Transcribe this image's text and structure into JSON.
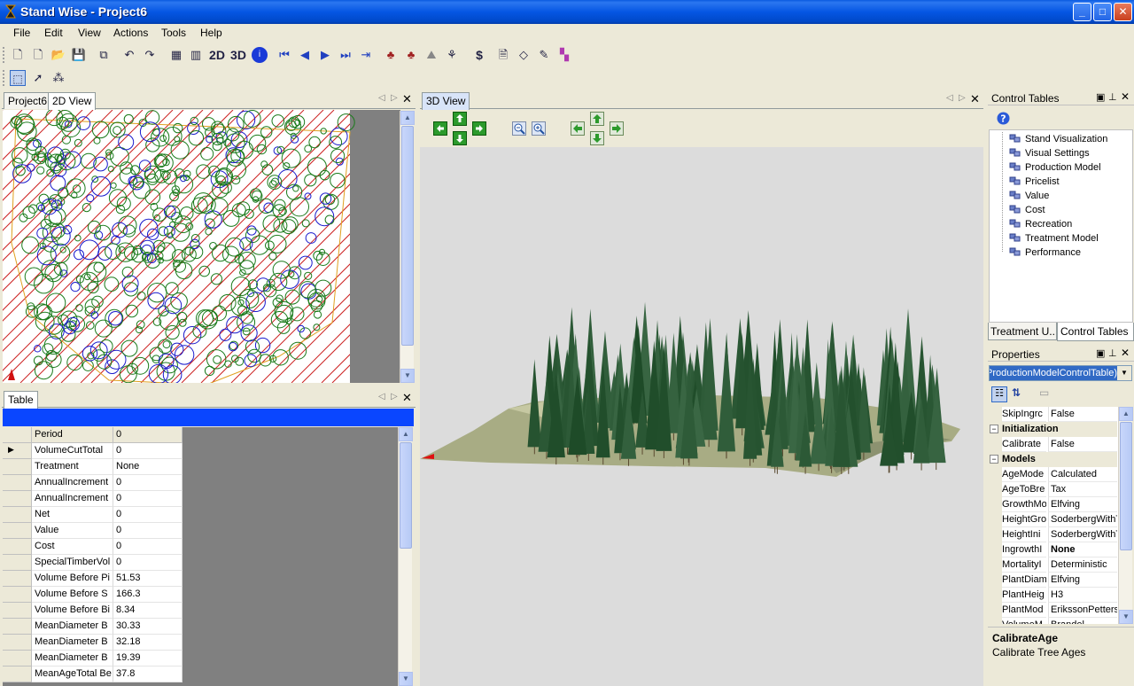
{
  "window": {
    "title": "Stand Wise - Project6",
    "controls": {
      "minimize": "_",
      "maximize": "□",
      "close": "✕"
    }
  },
  "menu": [
    "File",
    "Edit",
    "View",
    "Actions",
    "Tools",
    "Help"
  ],
  "toolbar": {
    "label_2d": "2D",
    "label_3d": "3D",
    "label_dollar": "$"
  },
  "left_top": {
    "tabs": [
      "Project6",
      "2D View"
    ]
  },
  "left_bottom": {
    "tab": "Table",
    "columns": [
      "Period",
      "0"
    ],
    "rows": [
      {
        "name": "VolumeCutTotal",
        "value": "0"
      },
      {
        "name": "Treatment",
        "value": "None"
      },
      {
        "name": "AnnualIncrement",
        "value": "0"
      },
      {
        "name": "AnnualIncrement",
        "value": "0"
      },
      {
        "name": "Net",
        "value": "0"
      },
      {
        "name": "Value",
        "value": "0"
      },
      {
        "name": "Cost",
        "value": "0"
      },
      {
        "name": "SpecialTimberVol",
        "value": "0"
      },
      {
        "name": "Volume Before Pi",
        "value": "51.53"
      },
      {
        "name": "Volume Before S",
        "value": "166.3"
      },
      {
        "name": "Volume Before Bi",
        "value": "8.34"
      },
      {
        "name": "MeanDiameter B",
        "value": "30.33"
      },
      {
        "name": "MeanDiameter B",
        "value": "32.18"
      },
      {
        "name": "MeanDiameter B",
        "value": "19.39"
      },
      {
        "name": "MeanAgeTotal Be",
        "value": "37.8"
      }
    ]
  },
  "center": {
    "tab": "3D View"
  },
  "control_tables": {
    "title": "Control Tables",
    "items": [
      "Stand Visualization",
      "Visual Settings",
      "Production Model",
      "Pricelist",
      "Value",
      "Cost",
      "Recreation",
      "Treatment Model",
      "Performance"
    ],
    "bottom_tabs": [
      "Treatment U...",
      "Control Tables"
    ]
  },
  "properties": {
    "title": "Properties",
    "selector": "(ProductionModelControlTable)",
    "rows": [
      {
        "type": "prop",
        "name": "SkipIngrc",
        "value": "False"
      },
      {
        "type": "cat",
        "name": "Initialization"
      },
      {
        "type": "prop",
        "name": "Calibrate",
        "value": "False"
      },
      {
        "type": "cat",
        "name": "Models"
      },
      {
        "type": "prop",
        "name": "AgeMode",
        "value": "Calculated"
      },
      {
        "type": "prop",
        "name": "AgeToBre",
        "value": "Tax"
      },
      {
        "type": "prop",
        "name": "GrowthMo",
        "value": "Elfving"
      },
      {
        "type": "prop",
        "name": "HeightGro",
        "value": "SoderbergWithT"
      },
      {
        "type": "prop",
        "name": "HeightIni",
        "value": "SoderbergWithT"
      },
      {
        "type": "prop",
        "name": "IngrowthI",
        "value": "None",
        "bold": true
      },
      {
        "type": "prop",
        "name": "MortalityI",
        "value": "Deterministic"
      },
      {
        "type": "prop",
        "name": "PlantDiam",
        "value": "Elfving"
      },
      {
        "type": "prop",
        "name": "PlantHeig",
        "value": "H3"
      },
      {
        "type": "prop",
        "name": "PlantMod",
        "value": "ErikssonPetters"
      },
      {
        "type": "prop",
        "name": "VolumeM",
        "value": "Brandel"
      }
    ],
    "help_title": "CalibrateAge",
    "help_text": "Calibrate Tree Ages"
  },
  "colors": {
    "title_blue": "#0556e3",
    "selection_blue": "#0a46ff",
    "tree_green": "#1a7a1a",
    "tree_blue": "#1a1acc",
    "hatch_red": "#cc2222",
    "boundary": "#e0a020"
  }
}
